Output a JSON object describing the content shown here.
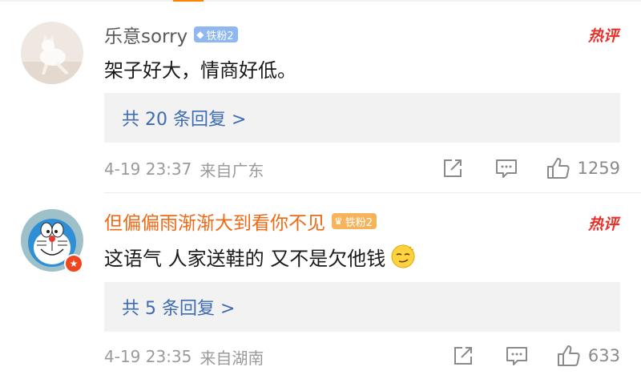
{
  "comments": [
    {
      "username": "乐意sorry",
      "badge_label": "铁粉2",
      "badge_icon": "diamond-icon",
      "hot_label": "热评",
      "text": "架子好大，情商好低。",
      "replies_label": "共 20 条回复 >",
      "time": "4-19 23:37",
      "location": "来自广东",
      "like_count": "1259",
      "avatar": "cat-photo-avatar"
    },
    {
      "username": "但偏偏雨渐渐大到看你不见",
      "badge_label": "铁粉2",
      "badge_icon": "crown-icon",
      "hot_label": "热评",
      "text": "这语气 人家送鞋的 又不是欠他钱",
      "emoji": "smirk-emoji",
      "replies_label": "共 5 条回复 >",
      "time": "4-19 23:35",
      "location": "来自湖南",
      "like_count": "633",
      "avatar": "doraemon-avatar",
      "avatar_badge": "verified-badge"
    }
  ],
  "colors": {
    "accent": "#ff8200",
    "link": "#3d6bb4",
    "hot": "#e8312b",
    "vip_name": "#f06a15",
    "meta": "#9a9a9a"
  }
}
